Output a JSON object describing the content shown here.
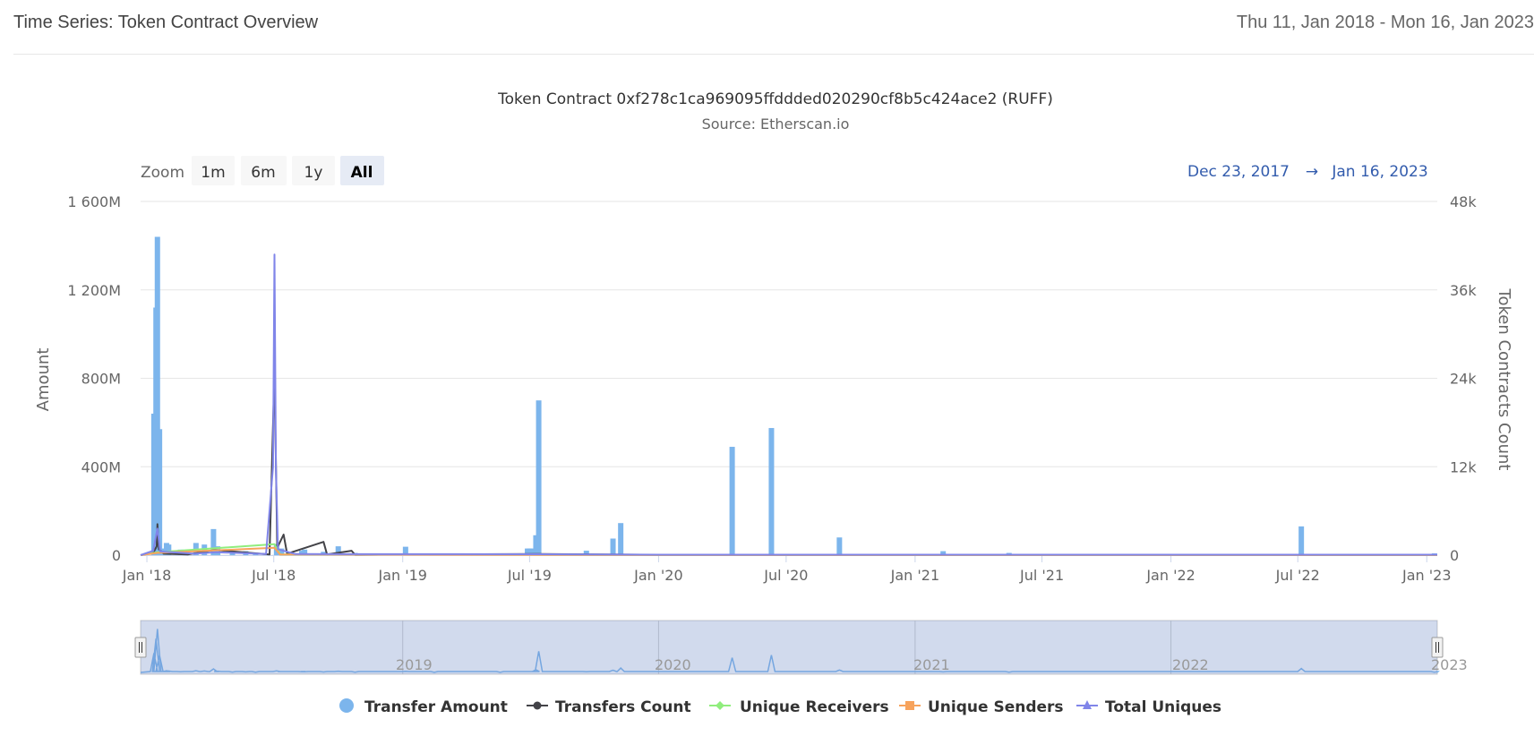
{
  "header": {
    "title": "Time Series: Token Contract Overview",
    "date_range": "Thu 11, Jan 2018 - Mon 16, Jan 2023"
  },
  "range_selector": {
    "zoom_label": "Zoom",
    "buttons": [
      {
        "label": "1m",
        "selected": false
      },
      {
        "label": "6m",
        "selected": false
      },
      {
        "label": "1y",
        "selected": false
      },
      {
        "label": "All",
        "selected": true
      }
    ],
    "from": "Dec 23, 2017",
    "arrow": "→",
    "to": "Jan 16, 2023"
  },
  "navigator": {
    "labels": [
      "2019",
      "2020",
      "2021",
      "2022",
      "2023"
    ]
  },
  "colors": {
    "transfer_amount": "#7cb5ec",
    "transfers_count": "#434348",
    "unique_receivers": "#90ed7d",
    "unique_senders": "#f7a35c",
    "total_uniques": "#8085e9",
    "grid": "#e6e6e6",
    "navigator_mask": "rgba(102,133,194,0.3)",
    "range_text": "#335cad"
  },
  "chart_data": {
    "type": "bar",
    "title": "Token Contract 0xf278c1ca969095ffddded020290cf8b5c424ace2 (RUFF)",
    "subtitle": "Source: Etherscan.io",
    "ylabel": "Amount",
    "y2label": "Token Contracts Count",
    "ylim": [
      0,
      1600000000
    ],
    "y2lim": [
      0,
      48000
    ],
    "xlim": [
      "2017-12-23",
      "2023-01-16"
    ],
    "yticks": [
      {
        "value": 0,
        "label": "0"
      },
      {
        "value": 400000000,
        "label": "400M"
      },
      {
        "value": 800000000,
        "label": "800M"
      },
      {
        "value": 1200000000,
        "label": "1 200M"
      },
      {
        "value": 1600000000,
        "label": "1 600M"
      }
    ],
    "y2ticks": [
      {
        "value": 0,
        "label": "0"
      },
      {
        "value": 12000,
        "label": "12k"
      },
      {
        "value": 24000,
        "label": "24k"
      },
      {
        "value": 36000,
        "label": "36k"
      },
      {
        "value": 48000,
        "label": "48k"
      }
    ],
    "xticks": [
      {
        "date": "2018-01-01",
        "label": "Jan '18"
      },
      {
        "date": "2018-07-01",
        "label": "Jul '18"
      },
      {
        "date": "2019-01-01",
        "label": "Jan '19"
      },
      {
        "date": "2019-07-01",
        "label": "Jul '19"
      },
      {
        "date": "2020-01-01",
        "label": "Jan '20"
      },
      {
        "date": "2020-07-01",
        "label": "Jul '20"
      },
      {
        "date": "2021-01-01",
        "label": "Jan '21"
      },
      {
        "date": "2021-07-01",
        "label": "Jul '21"
      },
      {
        "date": "2022-01-01",
        "label": "Jan '22"
      },
      {
        "date": "2022-07-01",
        "label": "Jul '22"
      },
      {
        "date": "2023-01-01",
        "label": "Jan '23"
      }
    ],
    "legend_position": "bottom",
    "series": [
      {
        "name": "Transfer Amount",
        "type": "column",
        "axis": "left",
        "points": [
          [
            "2018-01-11",
            640000000
          ],
          [
            "2018-01-14",
            1120000000
          ],
          [
            "2018-01-16",
            1440000000
          ],
          [
            "2018-01-19",
            570000000
          ],
          [
            "2018-01-22",
            30000000
          ],
          [
            "2018-01-29",
            55000000
          ],
          [
            "2018-02-01",
            48000000
          ],
          [
            "2018-02-18",
            25000000
          ],
          [
            "2018-03-12",
            55000000
          ],
          [
            "2018-03-24",
            48000000
          ],
          [
            "2018-04-06",
            118000000
          ],
          [
            "2018-04-12",
            40000000
          ],
          [
            "2018-05-03",
            12000000
          ],
          [
            "2018-05-22",
            18000000
          ],
          [
            "2018-06-05",
            10000000
          ],
          [
            "2018-07-05",
            50000000
          ],
          [
            "2018-07-12",
            30000000
          ],
          [
            "2018-08-10",
            20000000
          ],
          [
            "2018-08-14",
            25000000
          ],
          [
            "2018-09-10",
            15000000
          ],
          [
            "2018-10-01",
            40000000
          ],
          [
            "2018-10-25",
            10000000
          ],
          [
            "2019-01-05",
            38000000
          ],
          [
            "2019-02-15",
            5000000
          ],
          [
            "2019-05-20",
            5000000
          ],
          [
            "2019-06-28",
            30000000
          ],
          [
            "2019-07-01",
            30000000
          ],
          [
            "2019-07-04",
            30000000
          ],
          [
            "2019-07-10",
            90000000
          ],
          [
            "2019-07-14",
            700000000
          ],
          [
            "2019-09-20",
            20000000
          ],
          [
            "2019-10-28",
            75000000
          ],
          [
            "2019-11-08",
            145000000
          ],
          [
            "2020-04-15",
            490000000
          ],
          [
            "2020-06-10",
            575000000
          ],
          [
            "2020-09-15",
            80000000
          ],
          [
            "2021-02-10",
            18000000
          ],
          [
            "2021-05-15",
            10000000
          ],
          [
            "2022-07-06",
            130000000
          ],
          [
            "2023-01-12",
            8000000
          ]
        ]
      },
      {
        "name": "Transfers Count",
        "type": "line",
        "axis": "right",
        "points": [
          [
            "2017-12-23",
            0
          ],
          [
            "2018-01-10",
            300
          ],
          [
            "2018-01-15",
            1200
          ],
          [
            "2018-01-16",
            4200
          ],
          [
            "2018-01-18",
            800
          ],
          [
            "2018-01-25",
            200
          ],
          [
            "2018-03-01",
            100
          ],
          [
            "2018-04-08",
            700
          ],
          [
            "2018-06-25",
            100
          ],
          [
            "2018-07-02",
            25000
          ],
          [
            "2018-07-06",
            1000
          ],
          [
            "2018-07-15",
            2800
          ],
          [
            "2018-07-20",
            200
          ],
          [
            "2018-09-10",
            1800
          ],
          [
            "2018-09-15",
            100
          ],
          [
            "2018-10-20",
            600
          ],
          [
            "2018-10-25",
            50
          ],
          [
            "2019-07-14",
            150
          ],
          [
            "2020-01-01",
            50
          ],
          [
            "2023-01-16",
            40
          ]
        ]
      },
      {
        "name": "Unique Receivers",
        "type": "line",
        "axis": "right",
        "points": [
          [
            "2017-12-23",
            0
          ],
          [
            "2018-01-16",
            400
          ],
          [
            "2018-07-02",
            1500
          ],
          [
            "2018-07-10",
            100
          ],
          [
            "2020-01-01",
            20
          ],
          [
            "2023-01-16",
            20
          ]
        ]
      },
      {
        "name": "Unique Senders",
        "type": "line",
        "axis": "right",
        "points": [
          [
            "2017-12-23",
            0
          ],
          [
            "2018-01-16",
            300
          ],
          [
            "2018-07-02",
            1000
          ],
          [
            "2018-07-10",
            80
          ],
          [
            "2020-01-01",
            15
          ],
          [
            "2023-01-16",
            15
          ]
        ]
      },
      {
        "name": "Total Uniques",
        "type": "line",
        "axis": "right",
        "points": [
          [
            "2017-12-23",
            0
          ],
          [
            "2018-01-10",
            600
          ],
          [
            "2018-01-16",
            3600
          ],
          [
            "2018-01-20",
            500
          ],
          [
            "2018-03-10",
            200
          ],
          [
            "2018-04-10",
            400
          ],
          [
            "2018-06-20",
            150
          ],
          [
            "2018-06-30",
            12000
          ],
          [
            "2018-07-02",
            40800
          ],
          [
            "2018-07-04",
            12000
          ],
          [
            "2018-07-07",
            800
          ],
          [
            "2018-08-01",
            150
          ],
          [
            "2019-07-14",
            120
          ],
          [
            "2020-01-01",
            60
          ],
          [
            "2023-01-16",
            60
          ]
        ]
      }
    ]
  }
}
